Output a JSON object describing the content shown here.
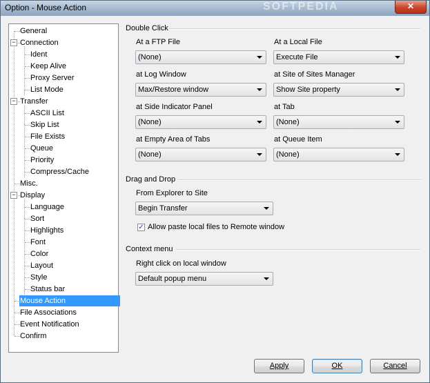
{
  "window": {
    "title": "Option - Mouse Action",
    "watermark": "SOFTPEDIA",
    "close_glyph": "✕"
  },
  "tree": {
    "items": [
      {
        "label": "General",
        "selected": false,
        "expander": ""
      },
      {
        "label": "Connection",
        "selected": false,
        "expander": "−"
      },
      {
        "label": "Ident",
        "selected": false,
        "expander": ""
      },
      {
        "label": "Keep Alive",
        "selected": false,
        "expander": ""
      },
      {
        "label": "Proxy Server",
        "selected": false,
        "expander": ""
      },
      {
        "label": "List Mode",
        "selected": false,
        "expander": ""
      },
      {
        "label": "Transfer",
        "selected": false,
        "expander": "−"
      },
      {
        "label": "ASCII List",
        "selected": false,
        "expander": ""
      },
      {
        "label": "Skip List",
        "selected": false,
        "expander": ""
      },
      {
        "label": "File Exists",
        "selected": false,
        "expander": ""
      },
      {
        "label": "Queue",
        "selected": false,
        "expander": ""
      },
      {
        "label": "Priority",
        "selected": false,
        "expander": ""
      },
      {
        "label": "Compress/Cache",
        "selected": false,
        "expander": ""
      },
      {
        "label": "Misc.",
        "selected": false,
        "expander": ""
      },
      {
        "label": "Display",
        "selected": false,
        "expander": "−"
      },
      {
        "label": "Language",
        "selected": false,
        "expander": ""
      },
      {
        "label": "Sort",
        "selected": false,
        "expander": ""
      },
      {
        "label": "Highlights",
        "selected": false,
        "expander": ""
      },
      {
        "label": "Font",
        "selected": false,
        "expander": ""
      },
      {
        "label": "Color",
        "selected": false,
        "expander": ""
      },
      {
        "label": "Layout",
        "selected": false,
        "expander": ""
      },
      {
        "label": "Style",
        "selected": false,
        "expander": ""
      },
      {
        "label": "Status bar",
        "selected": false,
        "expander": ""
      },
      {
        "label": "Mouse Action",
        "selected": true,
        "expander": ""
      },
      {
        "label": "File Associations",
        "selected": false,
        "expander": ""
      },
      {
        "label": "Event Notification",
        "selected": false,
        "expander": ""
      },
      {
        "label": "Confirm",
        "selected": false,
        "expander": ""
      }
    ]
  },
  "double_click": {
    "heading": "Double Click",
    "fields": [
      {
        "label": "At a FTP File",
        "value": "(None)"
      },
      {
        "label": "At a Local File",
        "value": "Execute File"
      },
      {
        "label": "at Log Window",
        "value": "Max/Restore window"
      },
      {
        "label": "at Site of Sites Manager",
        "value": "Show Site property"
      },
      {
        "label": "at Side Indicator Panel",
        "value": "(None)"
      },
      {
        "label": "at Tab",
        "value": "(None)"
      },
      {
        "label": "at Empty Area of Tabs",
        "value": "(None)"
      },
      {
        "label": "at Queue Item",
        "value": "(None)"
      }
    ]
  },
  "drag_drop": {
    "heading": "Drag and Drop",
    "explorer_label": "From Explorer to Site",
    "explorer_value": "Begin Transfer",
    "paste_checked": true,
    "check_glyph": "✓",
    "paste_label": "Allow paste local files to Remote window"
  },
  "context_menu": {
    "heading": "Context menu",
    "right_click_label": "Right click on local window",
    "right_click_value": "Default popup menu"
  },
  "buttons": {
    "apply": "Apply",
    "ok": "OK",
    "cancel": "Cancel"
  },
  "colors": {
    "selection": "#3399ff",
    "window_bg": "#f0f0f0"
  }
}
